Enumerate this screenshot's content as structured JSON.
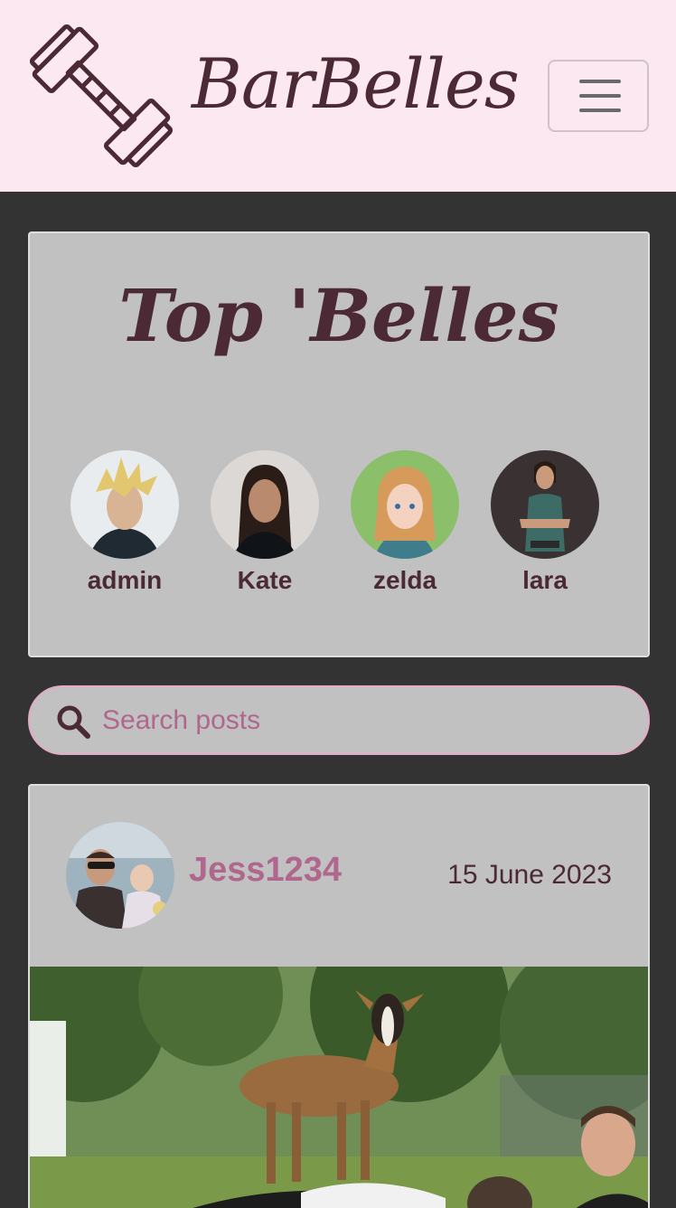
{
  "navbar": {
    "brand": "BarBelles",
    "logo_icon": "dumbbell-icon",
    "toggle_icon": "hamburger-menu-icon",
    "background": "#fbe8f1"
  },
  "top_belles": {
    "title": "Top 'Belles",
    "profiles": [
      {
        "name": "admin"
      },
      {
        "name": "Kate"
      },
      {
        "name": "zelda"
      },
      {
        "name": "lara"
      }
    ]
  },
  "search": {
    "placeholder": "Search posts",
    "icon": "search-icon"
  },
  "post": {
    "username": "Jess1234",
    "date": "15 June 2023"
  },
  "colors": {
    "page_background": "#333333",
    "card_background": "#c1c1c1",
    "heading": "#4b2a35",
    "accent": "#b0678d",
    "search_border": "#e6a9c6"
  }
}
